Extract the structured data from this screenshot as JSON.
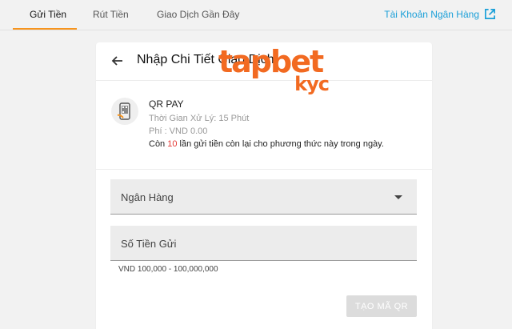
{
  "nav": {
    "tabs": [
      {
        "label": "Gửi Tiền"
      },
      {
        "label": "Rút Tiền"
      },
      {
        "label": "Giao Dịch Gần Đây"
      }
    ],
    "bank_account_link": "Tài Khoản Ngân Hàng"
  },
  "card": {
    "title": "Nhập Chi Tiết Giao Dịch"
  },
  "method": {
    "name": "QR PAY",
    "processing_time": "Thời Gian Xử Lý: 15 Phút",
    "fee": "Phí : VND 0.00",
    "note_prefix": "Còn ",
    "note_count": "10",
    "note_suffix": " lần gửi tiền còn lại cho phương thức này trong ngày."
  },
  "logo": {
    "main": "tapbet",
    "sub": "kyc"
  },
  "form": {
    "bank_label": "Ngân Hàng",
    "amount_label": "Số Tiền Gửi",
    "amount_hint": "VND 100,000 - 100,000,000",
    "submit_label": "TẠO MÃ QR"
  },
  "colors": {
    "accent": "#f7941d",
    "link": "#1a9fd8",
    "logo": "#f26a21",
    "highlight": "#e53935"
  }
}
